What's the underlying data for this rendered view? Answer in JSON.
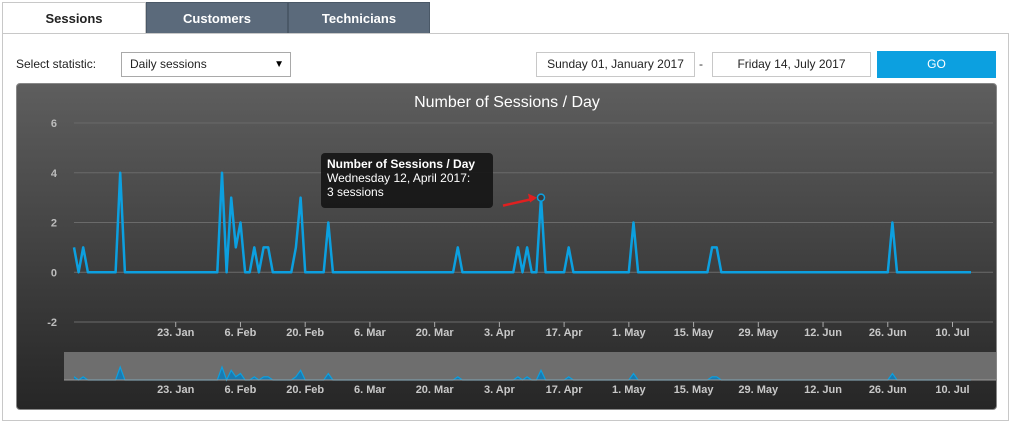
{
  "tabs": [
    {
      "label": "Sessions",
      "active": true
    },
    {
      "label": "Customers",
      "active": false
    },
    {
      "label": "Technicians",
      "active": false
    }
  ],
  "controls": {
    "statistic_label": "Select statistic:",
    "statistic_value": "Daily sessions",
    "date_from": "Sunday 01, January 2017",
    "separator": "-",
    "date_to": "Friday 14, July 2017",
    "go_label": "GO"
  },
  "tooltip": {
    "title": "Number of Sessions / Day",
    "line1": "Wednesday 12, April 2017:",
    "line2": "3 sessions"
  },
  "colors": {
    "series": "#0ca0e0",
    "go_button": "#0ca0e0",
    "pointer_arrow": "#e02020"
  },
  "chart_data": {
    "type": "line",
    "title": "Number of Sessions / Day",
    "xlabel": "",
    "ylabel": "",
    "ylim": [
      -2,
      6
    ],
    "yticks": [
      "6",
      "4",
      "2",
      "0",
      "-2"
    ],
    "xticks": [
      "23. Jan",
      "6. Feb",
      "20. Feb",
      "6. Mar",
      "20. Mar",
      "3. Apr",
      "17. Apr",
      "1. May",
      "15. May",
      "29. May",
      "12. Jun",
      "26. Jun",
      "10. Jul"
    ],
    "navigator_xticks": [
      "23. Jan",
      "6. Feb",
      "20. Feb",
      "6. Mar",
      "20. Mar",
      "3. Apr",
      "17. Apr",
      "1. May",
      "15. May",
      "29. May",
      "12. Jun",
      "26. Jun",
      "10. Jul"
    ],
    "grid": true,
    "legend": "none",
    "highlighted_point": {
      "x": "2017-04-12",
      "y": 3
    },
    "series": [
      {
        "x_start": "2017-01-01",
        "x_end": "2017-07-14",
        "points": [
          [
            "2017-01-01",
            1
          ],
          [
            "2017-01-02",
            0
          ],
          [
            "2017-01-03",
            1
          ],
          [
            "2017-01-04",
            0
          ],
          [
            "2017-01-10",
            0
          ],
          [
            "2017-01-11",
            4
          ],
          [
            "2017-01-12",
            0
          ],
          [
            "2017-02-01",
            0
          ],
          [
            "2017-02-02",
            4
          ],
          [
            "2017-02-03",
            0
          ],
          [
            "2017-02-04",
            3
          ],
          [
            "2017-02-05",
            1
          ],
          [
            "2017-02-06",
            2
          ],
          [
            "2017-02-07",
            0
          ],
          [
            "2017-02-08",
            0
          ],
          [
            "2017-02-09",
            1
          ],
          [
            "2017-02-10",
            0
          ],
          [
            "2017-02-11",
            1
          ],
          [
            "2017-02-12",
            1
          ],
          [
            "2017-02-13",
            0
          ],
          [
            "2017-02-17",
            0
          ],
          [
            "2017-02-18",
            1
          ],
          [
            "2017-02-19",
            3
          ],
          [
            "2017-02-20",
            0
          ],
          [
            "2017-02-24",
            0
          ],
          [
            "2017-02-25",
            2
          ],
          [
            "2017-02-26",
            0
          ],
          [
            "2017-03-24",
            0
          ],
          [
            "2017-03-25",
            1
          ],
          [
            "2017-03-26",
            0
          ],
          [
            "2017-04-06",
            0
          ],
          [
            "2017-04-07",
            1
          ],
          [
            "2017-04-08",
            0
          ],
          [
            "2017-04-09",
            1
          ],
          [
            "2017-04-10",
            0
          ],
          [
            "2017-04-11",
            0
          ],
          [
            "2017-04-12",
            3
          ],
          [
            "2017-04-13",
            0
          ],
          [
            "2017-04-17",
            0
          ],
          [
            "2017-04-18",
            1
          ],
          [
            "2017-04-19",
            0
          ],
          [
            "2017-05-01",
            0
          ],
          [
            "2017-05-02",
            2
          ],
          [
            "2017-05-03",
            0
          ],
          [
            "2017-05-18",
            0
          ],
          [
            "2017-05-19",
            1
          ],
          [
            "2017-05-20",
            1
          ],
          [
            "2017-05-21",
            0
          ],
          [
            "2017-06-26",
            0
          ],
          [
            "2017-06-27",
            2
          ],
          [
            "2017-06-28",
            0
          ],
          [
            "2017-07-14",
            0
          ]
        ]
      }
    ]
  }
}
